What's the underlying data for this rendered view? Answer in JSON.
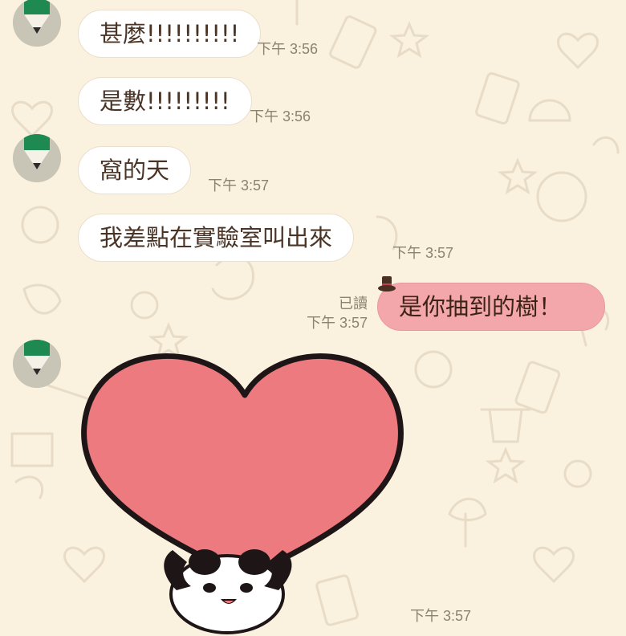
{
  "colors": {
    "background": "#fbf1df",
    "incoming_bubble": "#ffffff",
    "outgoing_bubble": "#f4a7ab",
    "text": "#4a3426",
    "time": "#8c8270",
    "avatar_green": "#1e8a52"
  },
  "messages": [
    {
      "text": "甚麼!!!!!!!!!!",
      "time": "下午 3:56"
    },
    {
      "text": "是數!!!!!!!!!",
      "time": "下午 3:56"
    },
    {
      "text": "窩的天",
      "time": "下午 3:57"
    },
    {
      "text": "我差點在實驗室叫出來",
      "time": "下午 3:57"
    }
  ],
  "outgoing": {
    "text": "是你抽到的樹！",
    "read_label": "已讀",
    "time": "下午 3:57"
  },
  "sticker": {
    "icon": "heart-panda-sticker",
    "time": "下午 3:57"
  }
}
